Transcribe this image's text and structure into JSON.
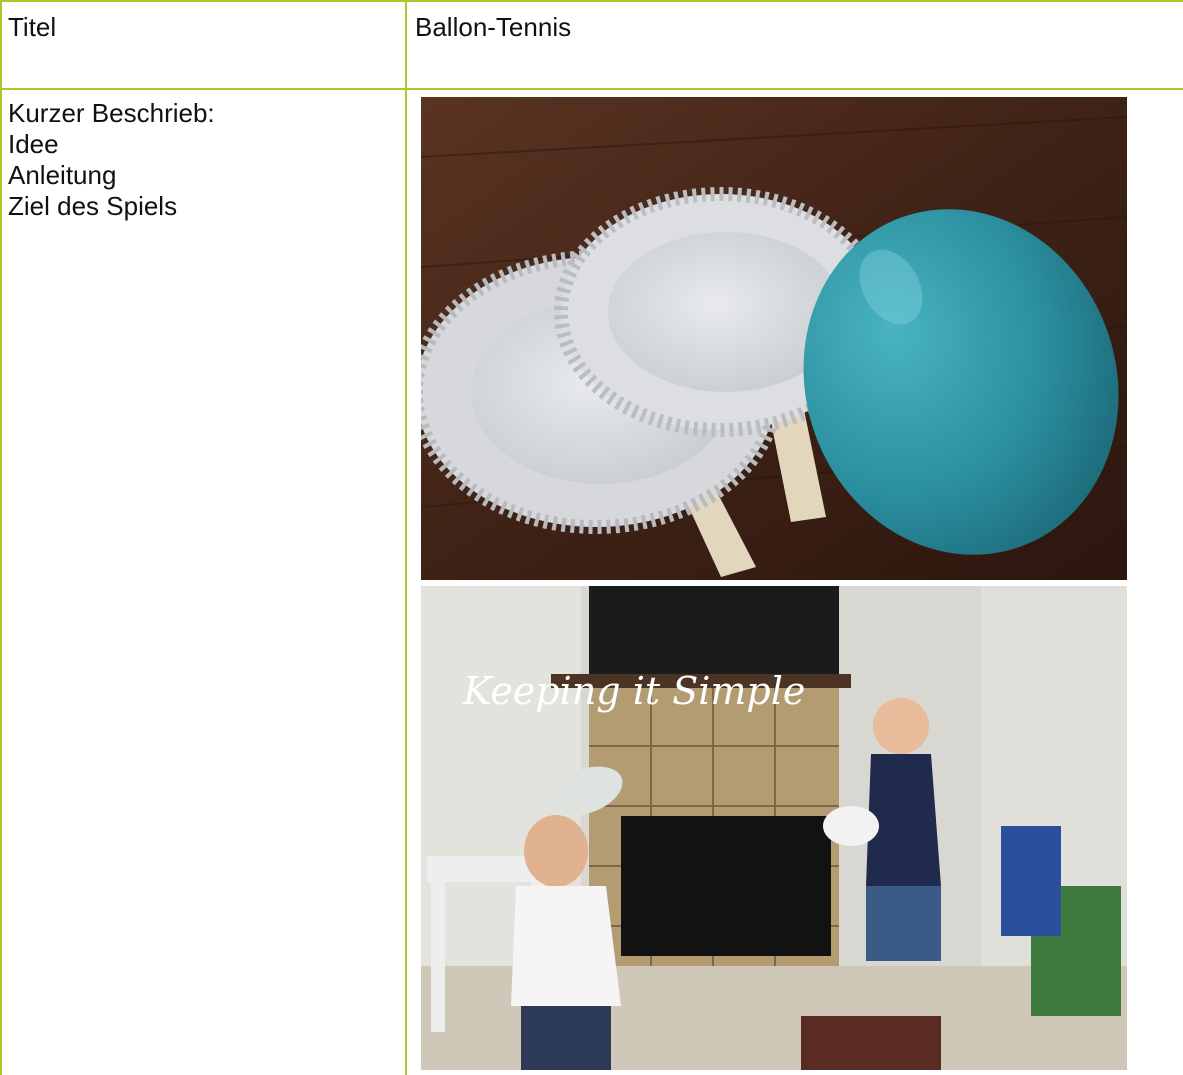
{
  "table": {
    "row1": {
      "label": "Titel",
      "value": "Ballon-Tennis"
    },
    "row2": {
      "label_lines": [
        "Kurzer Beschrieb:",
        "Idee",
        "Anleitung",
        "Ziel des Spiels"
      ],
      "photo_top": {
        "description_icon": "paper-plate-paddles-balloon-photo"
      },
      "photo_bottom": {
        "watermark": "Keeping it Simple",
        "description_icon": "kids-playing-balloon-tennis-photo"
      }
    }
  },
  "colors": {
    "border": "#b2c42a",
    "balloon": "#2a8e9e",
    "wood": "#4a2a1c"
  }
}
